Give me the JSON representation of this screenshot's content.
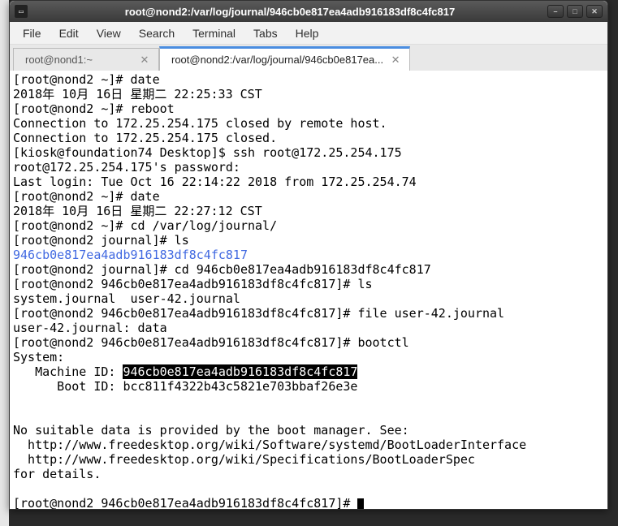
{
  "titlebar": {
    "title": "root@nond2:/var/log/journal/946cb0e817ea4adb916183df8c4fc817"
  },
  "menubar": {
    "file": "File",
    "edit": "Edit",
    "view": "View",
    "search": "Search",
    "terminal": "Terminal",
    "tabs": "Tabs",
    "help": "Help"
  },
  "tabs": {
    "tab0": {
      "label": "root@nond1:~"
    },
    "tab1": {
      "label": "root@nond2:/var/log/journal/946cb0e817ea..."
    }
  },
  "term": {
    "l01": "[root@nond2 ~]# date",
    "l02": "2018年 10月 16日 星期二 22:25:33 CST",
    "l03": "[root@nond2 ~]# reboot",
    "l04": "Connection to 172.25.254.175 closed by remote host.",
    "l05": "Connection to 172.25.254.175 closed.",
    "l06": "[kiosk@foundation74 Desktop]$ ssh root@172.25.254.175",
    "l07": "root@172.25.254.175's password: ",
    "l08": "Last login: Tue Oct 16 22:14:22 2018 from 172.25.254.74",
    "l09": "[root@nond2 ~]# date",
    "l10": "2018年 10月 16日 星期二 22:27:12 CST",
    "l11": "[root@nond2 ~]# cd /var/log/journal/",
    "l12": "[root@nond2 journal]# ls",
    "l13_dir": "946cb0e817ea4adb916183df8c4fc817",
    "l14": "[root@nond2 journal]# cd 946cb0e817ea4adb916183df8c4fc817",
    "l15": "[root@nond2 946cb0e817ea4adb916183df8c4fc817]# ls",
    "l16": "system.journal  user-42.journal",
    "l17": "[root@nond2 946cb0e817ea4adb916183df8c4fc817]# file user-42.journal",
    "l18": "user-42.journal: data",
    "l19": "[root@nond2 946cb0e817ea4adb916183df8c4fc817]# bootctl",
    "l20": "System:",
    "l21a": "   Machine ID: ",
    "l21b": "946cb0e817ea4adb916183df8c4fc817",
    "l22": "      Boot ID: bcc811f4322b43c5821e703bbaf26e3e",
    "l23": "",
    "l24": "",
    "l25": "No suitable data is provided by the boot manager. See:",
    "l26": "  http://www.freedesktop.org/wiki/Software/systemd/BootLoaderInterface",
    "l27": "  http://www.freedesktop.org/wiki/Specifications/BootLoaderSpec",
    "l28": "for details.",
    "l29": "",
    "l30": "[root@nond2 946cb0e817ea4adb916183df8c4fc817]# "
  }
}
